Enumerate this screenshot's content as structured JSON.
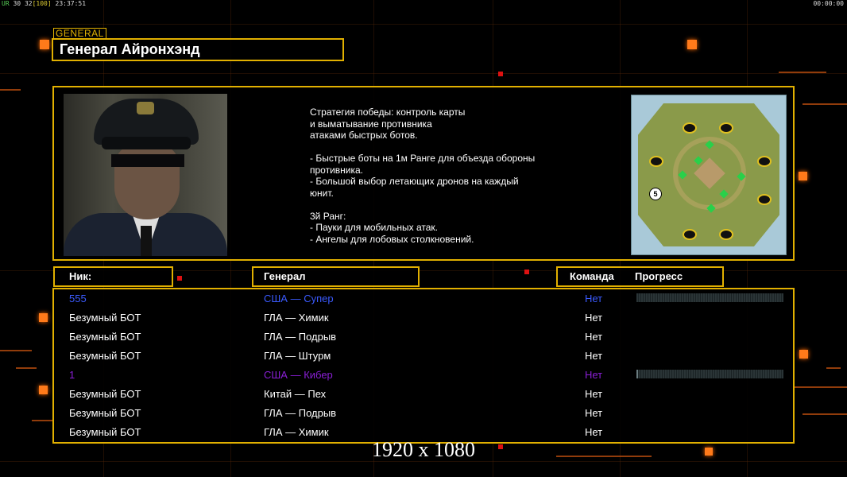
{
  "hud": {
    "ur_label": "UR",
    "fps": "30",
    "fps_cap": "32",
    "bracket_value": "[100]",
    "clock": "23:37:51",
    "timer": "00:00:00"
  },
  "general": {
    "badge": "GENERAL",
    "name": "Генерал Айронхэнд",
    "description": "Стратегия победы: контроль карты\nи выматывание противника\nатаками быстрых ботов.\n\n- Быстрые боты на 1м Ранге для объезда обороны\n противника.\n- Большой выбор летающих дронов на каждый\n юнит.\n\n3й Ранг:\n- Пауки для мобильных атак.\n- Ангелы для лобовых столкновений."
  },
  "map": {
    "label_5": "5",
    "land_color": "#8a9a4a",
    "water_color": "#a9c9d8"
  },
  "table": {
    "headers": {
      "nick": "Ник:",
      "general": "Генерал",
      "team": "Команда",
      "progress": "Прогресс"
    },
    "rows": [
      {
        "nick": "555",
        "general": "США — Супер",
        "team": "Нет",
        "color": "#3b5bff",
        "progress": 0.0
      },
      {
        "nick": "Безумный БОТ",
        "general": "ГЛА — Химик",
        "team": "Нет",
        "color": "#ffffff"
      },
      {
        "nick": "Безумный БОТ",
        "general": "ГЛА — Подрыв",
        "team": "Нет",
        "color": "#ffffff"
      },
      {
        "nick": "Безумный БОТ",
        "general": "ГЛА — Штурм",
        "team": "Нет",
        "color": "#ffffff"
      },
      {
        "nick": "1",
        "general": "США — Кибер",
        "team": "Нет",
        "color": "#8a1fd6",
        "progress": 0.01
      },
      {
        "nick": "Безумный БОТ",
        "general": "Китай — Пех",
        "team": "Нет",
        "color": "#ffffff"
      },
      {
        "nick": "Безумный БОТ",
        "general": "ГЛА — Подрыв",
        "team": "Нет",
        "color": "#ffffff"
      },
      {
        "nick": "Безумный БОТ",
        "general": "ГЛА — Химик",
        "team": "Нет",
        "color": "#ffffff"
      }
    ]
  },
  "resolution": "1920 x 1080",
  "colors": {
    "accent": "#e1b000",
    "decor": "#ff7a1a"
  }
}
